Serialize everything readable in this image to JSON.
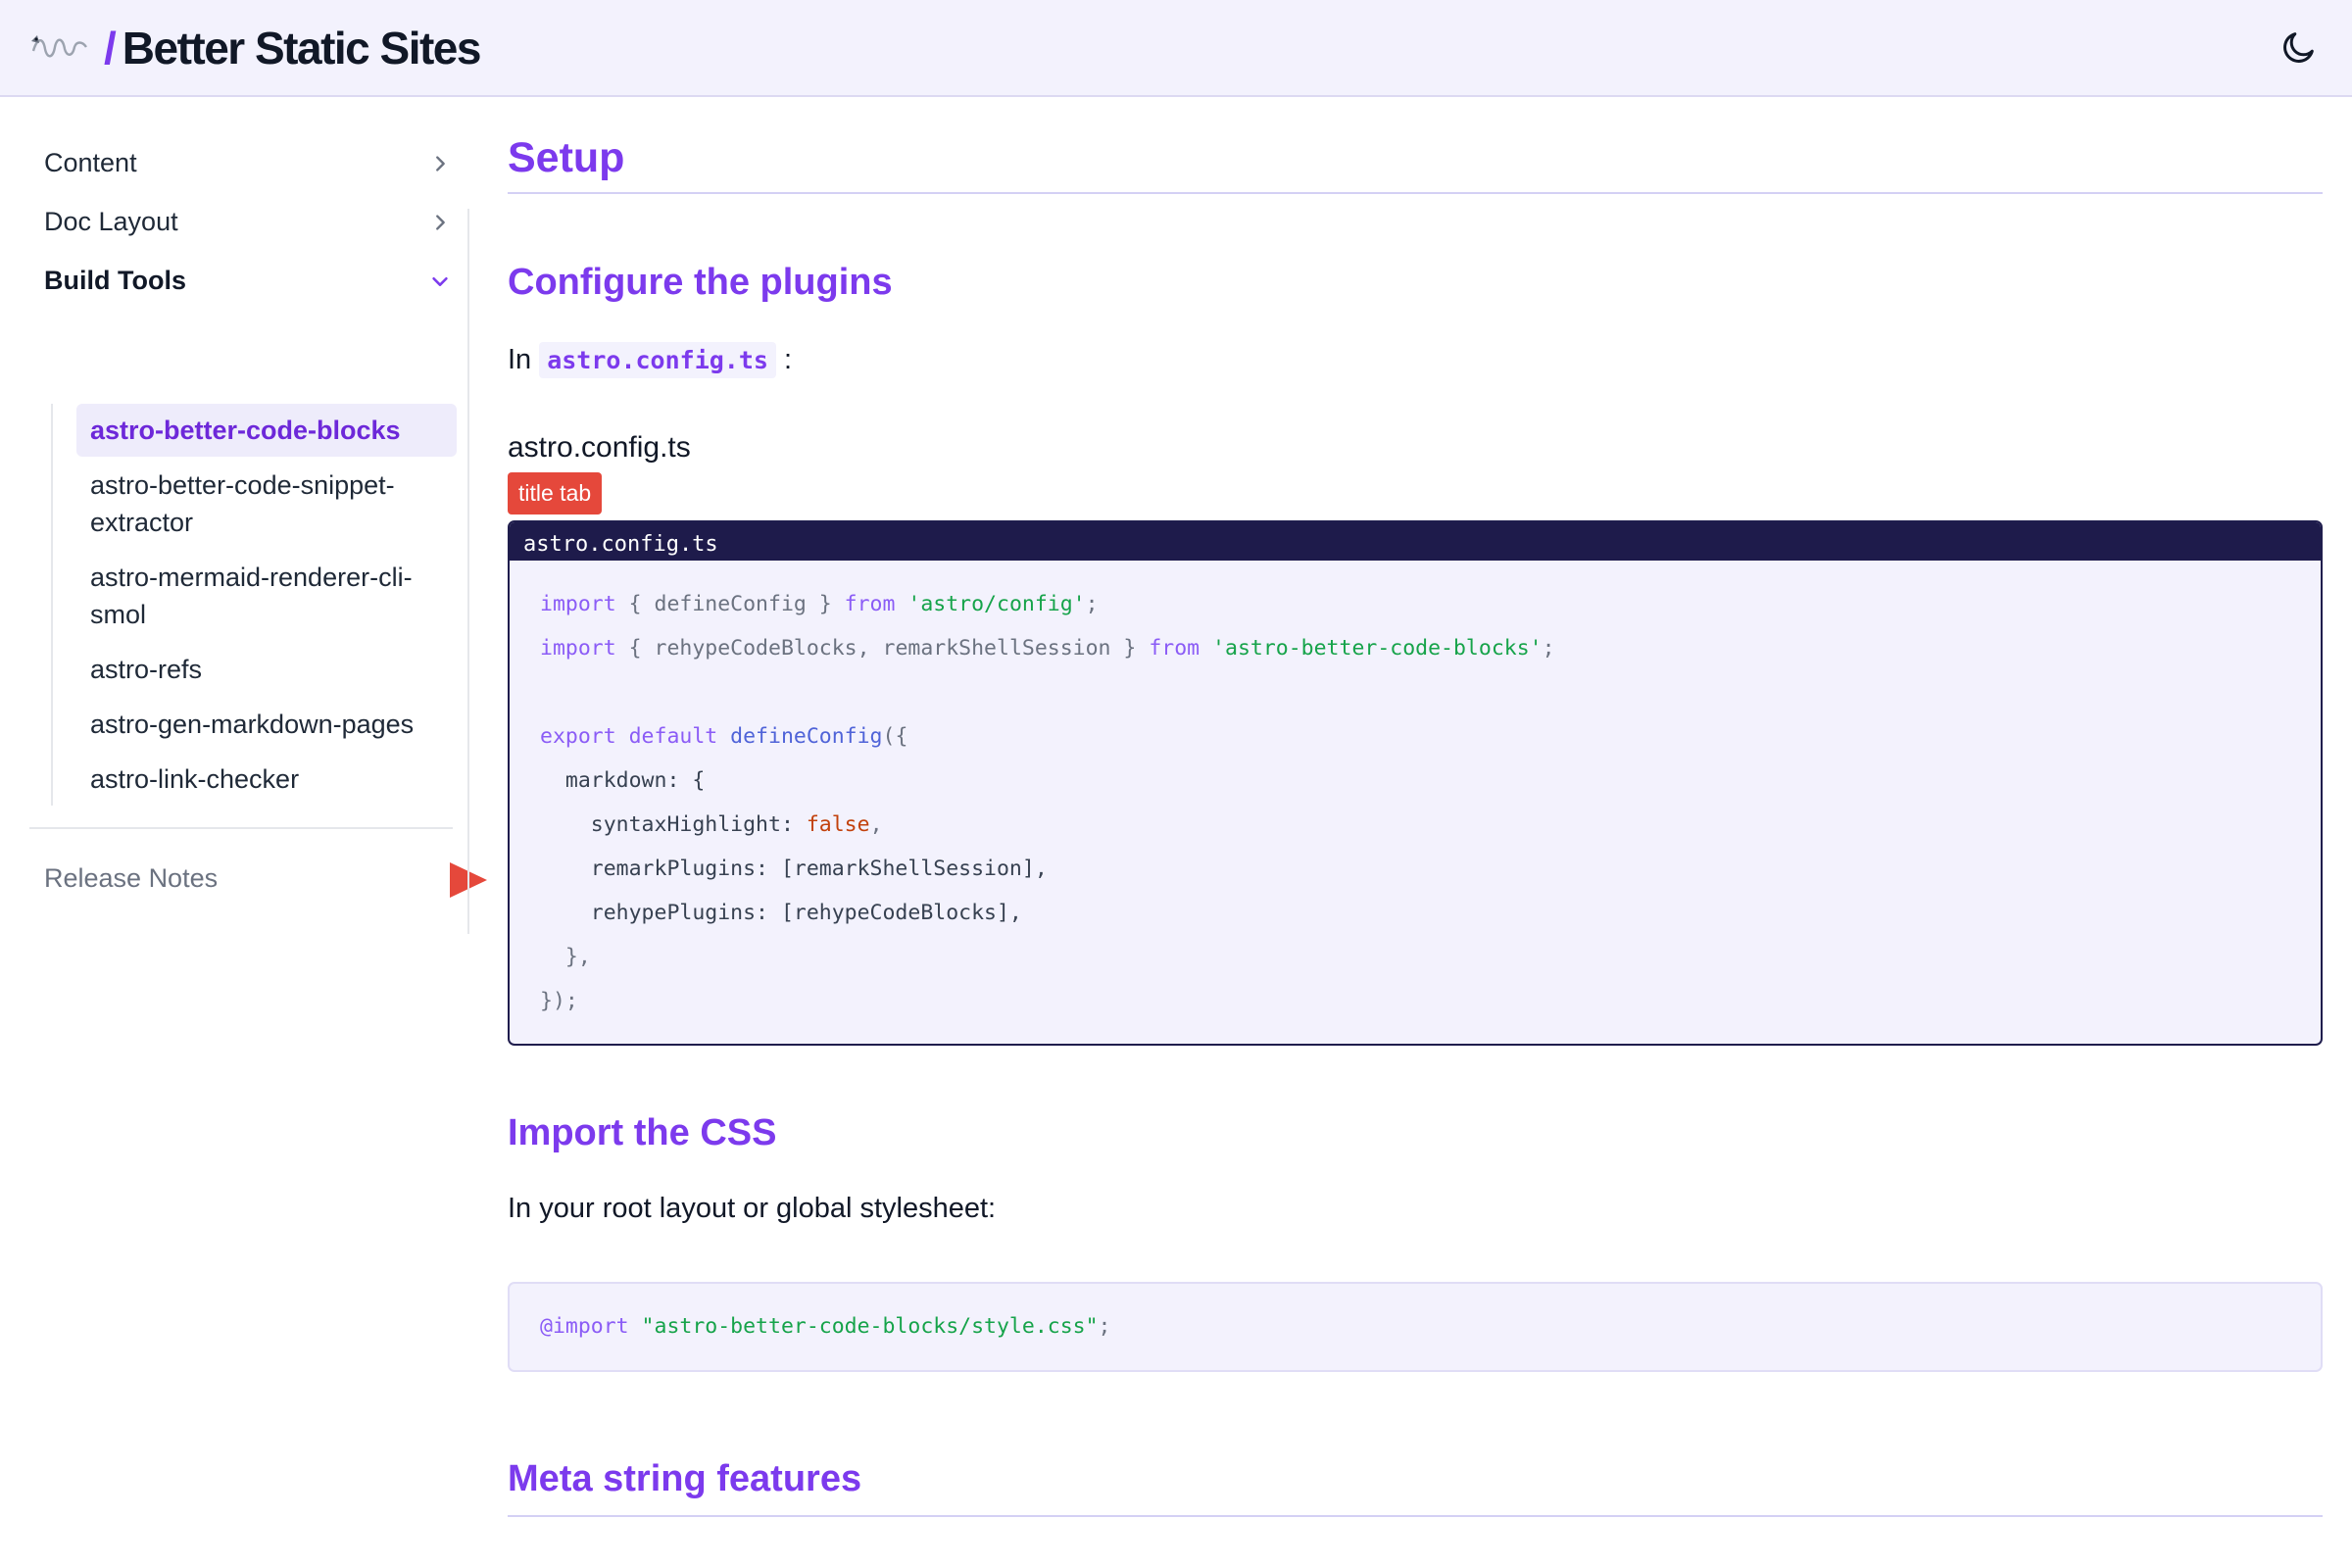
{
  "header": {
    "slash": "/",
    "title": "Better Static Sites",
    "logo_icon": "dragon-logo-icon",
    "theme_icon": "moon-icon"
  },
  "sidebar": {
    "groups": [
      {
        "label": "Content",
        "expanded": false
      },
      {
        "label": "Doc Layout",
        "expanded": false
      },
      {
        "label": "Build Tools",
        "expanded": true
      }
    ],
    "sub_items": [
      {
        "label": "astro-better-code-blocks",
        "current": true
      },
      {
        "label": "astro-better-code-snippet-extractor",
        "current": false
      },
      {
        "label": "astro-mermaid-renderer-cli-smol",
        "current": false
      },
      {
        "label": "astro-refs",
        "current": false
      },
      {
        "label": "astro-gen-markdown-pages",
        "current": false
      },
      {
        "label": "astro-link-checker",
        "current": false
      }
    ],
    "sub_items_wrapped": {
      "item1_line1": "astro-better-code-snippet-",
      "item1_line2": "extractor",
      "item2_line1": "astro-mermaid-renderer-cli-",
      "item2_line2": "smol"
    },
    "release_notes": "Release Notes"
  },
  "main": {
    "h1": "Setup",
    "section1": {
      "title": "Configure the plugins",
      "para_prefix": "In",
      "para_code": "astro.config.ts",
      "para_suffix": ":",
      "code_title": "astro.config.ts",
      "badge": "title tab",
      "tab_label": "astro.config.ts",
      "code": {
        "l1_kw": "import",
        "l1_a": " { defineConfig } ",
        "l1_from": "from",
        "l1_str": " 'astro/config'",
        "l1_end": ";",
        "l2_kw": "import",
        "l2_a": " { rehypeCodeBlocks, remarkShellSession } ",
        "l2_from": "from",
        "l2_str": " 'astro-better-code-blocks'",
        "l2_end": ";",
        "l4_kw": "export default",
        "l4_fn": " defineConfig",
        "l4_end": "({",
        "l5": "  markdown: {",
        "l6_a": "    syntaxHighlight: ",
        "l6_bool": "false",
        "l6_end": ",",
        "l7": "    remarkPlugins: [remarkShellSession],",
        "l8": "    rehypePlugins: [rehypeCodeBlocks],",
        "l9": "  },",
        "l10": "});"
      }
    },
    "section2": {
      "title": "Import the CSS",
      "para": "In your root layout or global stylesheet:",
      "code_kw": "@import",
      "code_str": " \"astro-better-code-blocks/style.css\"",
      "code_end": ";"
    },
    "section3": {
      "title": "Meta string features"
    }
  },
  "colors": {
    "accent": "#7c3aed",
    "badge": "#e5483b",
    "tab_bg": "#1e1b4b"
  }
}
